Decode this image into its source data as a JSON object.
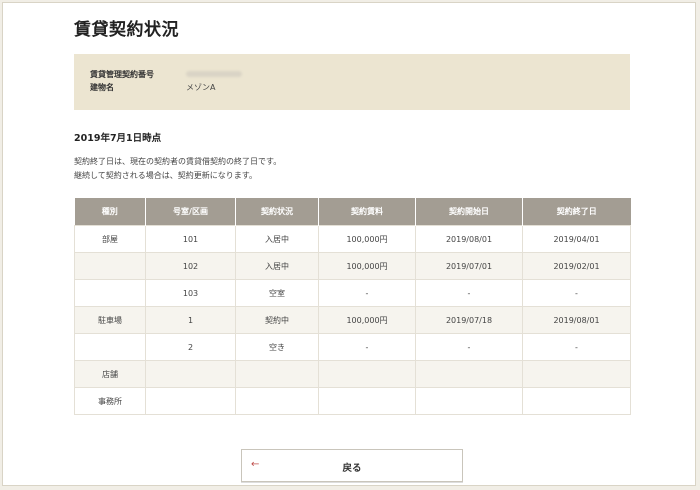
{
  "page": {
    "title": "賃貸契約状況"
  },
  "info": {
    "contract_number_label": "賃貸管理契約番号",
    "building_name_label": "建物名",
    "building_name_value": "メゾンA"
  },
  "status": {
    "as_of": "2019年7月1日時点",
    "note_line1": "契約終了日は、現在の契約者の賃貸借契約の終了日です。",
    "note_line2": "継続して契約される場合は、契約更新になります。"
  },
  "table": {
    "headers": [
      "種別",
      "号室/区画",
      "契約状況",
      "契約賃料",
      "契約開始日",
      "契約終了日"
    ],
    "rows": [
      [
        "部屋",
        "101",
        "入居中",
        "100,000円",
        "2019/08/01",
        "2019/04/01"
      ],
      [
        "",
        "102",
        "入居中",
        "100,000円",
        "2019/07/01",
        "2019/02/01"
      ],
      [
        "",
        "103",
        "空室",
        "-",
        "-",
        "-"
      ],
      [
        "駐車場",
        "1",
        "契約中",
        "100,000円",
        "2019/07/18",
        "2019/08/01"
      ],
      [
        "",
        "2",
        "空き",
        "-",
        "-",
        "-"
      ],
      [
        "店舗",
        "",
        "",
        "",
        "",
        ""
      ],
      [
        "事務所",
        "",
        "",
        "",
        "",
        ""
      ]
    ]
  },
  "actions": {
    "back_label": "戻る",
    "back_icon": "arrow-left-icon"
  },
  "colors": {
    "accent": "#c0504d",
    "header_bg": "#a39d93",
    "info_bg": "#ece5d1",
    "page_bg": "#f1eee6"
  }
}
